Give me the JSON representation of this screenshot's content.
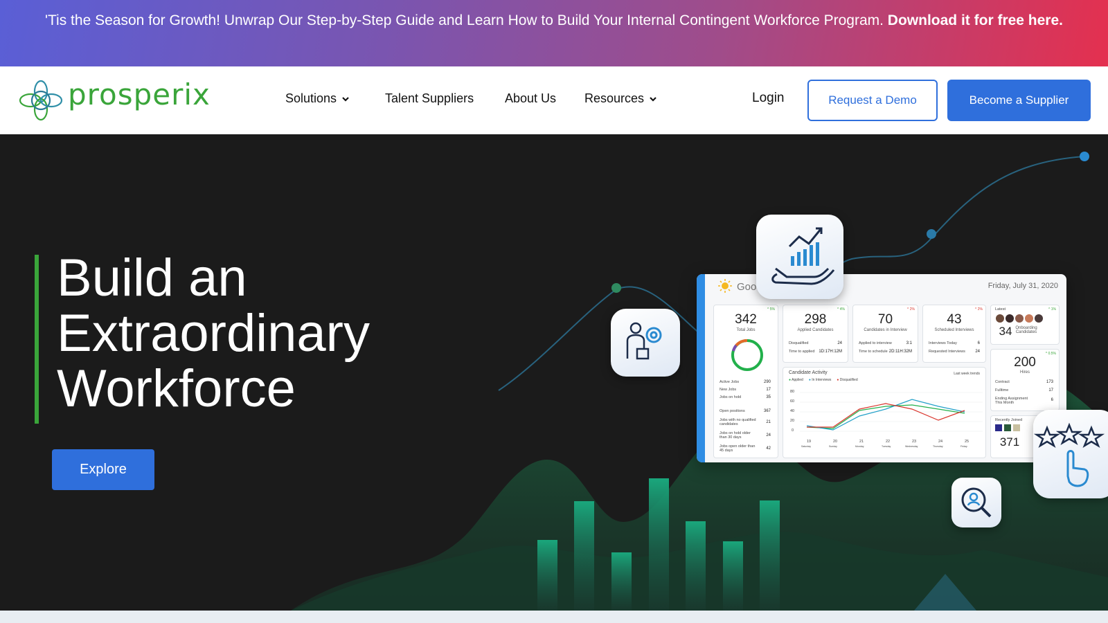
{
  "banner": {
    "text": "'Tis the Season for Growth! Unwrap Our Step-by-Step Guide and Learn How to Build Your Internal Contingent Workforce Program. ",
    "link": "Download it for free here."
  },
  "nav": {
    "logo_text": "prosperix",
    "items": [
      {
        "label": "Solutions",
        "dropdown": true
      },
      {
        "label": "Talent Suppliers",
        "dropdown": false
      },
      {
        "label": "About Us",
        "dropdown": false
      },
      {
        "label": "Resources",
        "dropdown": true
      }
    ],
    "login": "Login",
    "demo_button": "Request a Demo",
    "supplier_button": "Become a Supplier"
  },
  "hero": {
    "headline_line1": "Build an",
    "headline_line2": "Extraordinary",
    "headline_line3": "Workforce",
    "cta": "Explore"
  },
  "dashboard": {
    "greeting": "Good",
    "date": "Friday, July 31, 2020",
    "tiles": [
      {
        "value": "342",
        "label": "Total Jobs",
        "change": "^ 5%"
      },
      {
        "value": "298",
        "label": "Applied Candidates",
        "change": "^ 4%"
      },
      {
        "value": "70",
        "label": "Candidates in Interview",
        "change": "^ 2%"
      },
      {
        "value": "43",
        "label": "Scheduled Interviews",
        "change": "^ 2%"
      }
    ],
    "jobs_rows": [
      {
        "label": "Active Jobs",
        "value": "290"
      },
      {
        "label": "New Jobs",
        "value": "17"
      },
      {
        "label": "Jobs on hold",
        "value": "35"
      }
    ],
    "open_rows": [
      {
        "label": "Open positions",
        "value": "367"
      },
      {
        "label": "Jobs with no qualified candidates",
        "value": "21"
      },
      {
        "label": "Jobs on hold older than 30 days",
        "value": "24"
      },
      {
        "label": "Jobs open older than 45 days",
        "value": "42"
      }
    ],
    "applied_rows": [
      {
        "label": "Disqualified",
        "value": "24"
      },
      {
        "label": "Time to applied",
        "value": "1D:17H:12M"
      }
    ],
    "interview_rows": [
      {
        "label": "Applied to interview",
        "value": "3:1"
      },
      {
        "label": "Time to schedule",
        "value": "2D:11H:32M"
      }
    ],
    "scheduled_rows": [
      {
        "label": "Interviews Today",
        "value": "6"
      },
      {
        "label": "Requested Interviews",
        "value": "24"
      }
    ],
    "onboarding": {
      "value": "34",
      "label": "Onboarding Candidates",
      "header": "Latest",
      "change": "^ 1%"
    },
    "hires": {
      "value": "200",
      "label": "Hires",
      "change": "^ 0.5%"
    },
    "hires_rows": [
      {
        "label": "Contract",
        "value": "173"
      },
      {
        "label": "Fulltime",
        "value": "17"
      },
      {
        "label": "Ending Assignment This Month",
        "value": "6"
      }
    ],
    "recent": {
      "header": "Recently Joined",
      "value": "371"
    },
    "activity": {
      "title": "Candidate Activity",
      "filter": "Last week trends",
      "legend": [
        "Applied",
        "In Interviews",
        "Disqualified"
      ],
      "yticks": [
        "80",
        "60",
        "40",
        "20",
        "0"
      ],
      "xticks": [
        "19",
        "20",
        "21",
        "22",
        "23",
        "24",
        "25"
      ],
      "xdays": [
        "Saturday",
        "Sunday",
        "Monday",
        "Tuesday",
        "Wednesday",
        "Thursday",
        "Friday"
      ]
    }
  },
  "colors": {
    "accent_green": "#3aa53a",
    "primary_blue": "#2f6fdc",
    "hero_bg": "#1b1b1b"
  }
}
